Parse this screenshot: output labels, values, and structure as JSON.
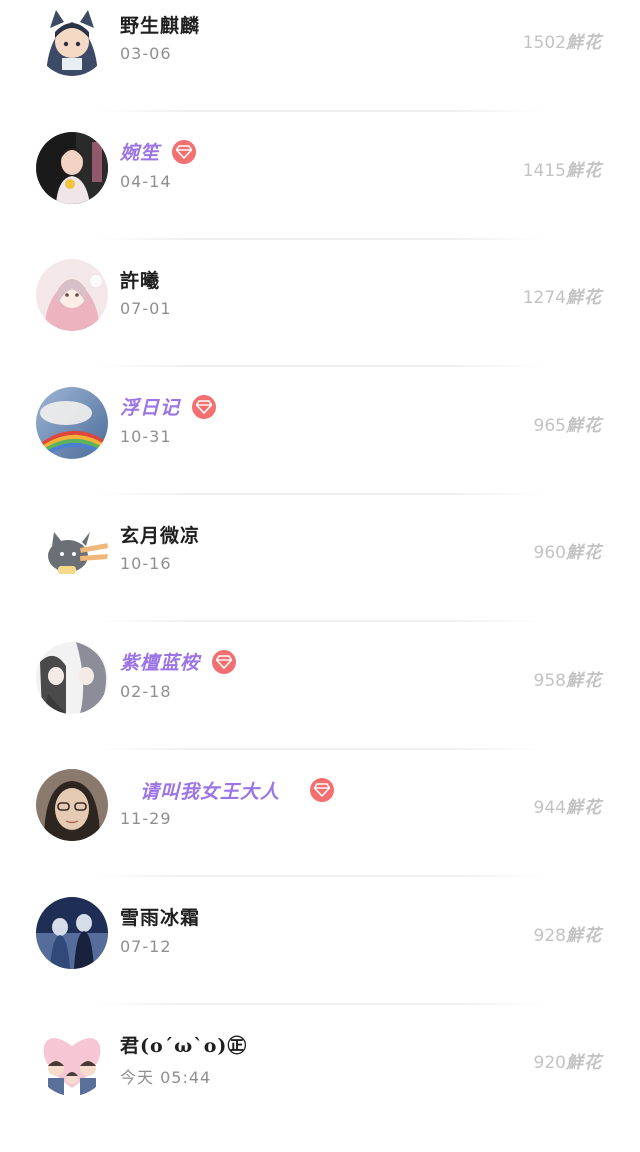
{
  "ranking": {
    "items": [
      {
        "name": "野生麒麟",
        "date": "03-06",
        "count": "1502",
        "unit": "鮮花",
        "vip": false,
        "avatar": "avatar-boy-hood",
        "avatar_colors": [
          "#3d4a66",
          "#f5d9c4",
          "#2b3347"
        ]
      },
      {
        "name": "婉笙",
        "date": "04-14",
        "count": "1415",
        "unit": "鮮花",
        "vip": true,
        "avatar": "avatar-girl-photo",
        "avatar_colors": [
          "#1a1a1a",
          "#f0e6ea",
          "#d87a9a"
        ]
      },
      {
        "name": "許曦",
        "date": "07-01",
        "count": "1274",
        "unit": "鮮花",
        "vip": false,
        "avatar": "avatar-anime-girl",
        "avatar_colors": [
          "#f3e7ea",
          "#e8a7b4",
          "#d8c0c8"
        ]
      },
      {
        "name": "浮日记",
        "date": "10-31",
        "count": "965",
        "unit": "鮮花",
        "vip": true,
        "avatar": "avatar-sky-rainbow",
        "avatar_colors": [
          "#6f8fb8",
          "#c9a86a",
          "#4a6b98"
        ]
      },
      {
        "name": "玄月微凉",
        "date": "10-16",
        "count": "960",
        "unit": "鮮花",
        "vip": false,
        "avatar": "avatar-cartoon-cat",
        "avatar_colors": [
          "#ffffff",
          "#6b6f76",
          "#f0b77a"
        ]
      },
      {
        "name": "紫檀蓝桉",
        "date": "02-18",
        "count": "958",
        "unit": "鮮花",
        "vip": true,
        "avatar": "avatar-ink-couple",
        "avatar_colors": [
          "#f2f2f2",
          "#2a2a2a",
          "#8d8d9a"
        ]
      },
      {
        "name": "请叫我女王大人",
        "date": "11-29",
        "count": "944",
        "unit": "鮮花",
        "vip": true,
        "avatar": "avatar-glasses-woman",
        "avatar_colors": [
          "#8a7a6e",
          "#e6cbb4",
          "#2e2420"
        ]
      },
      {
        "name": "雪雨冰霜",
        "date": "07-12",
        "count": "928",
        "unit": "鮮花",
        "vip": false,
        "avatar": "avatar-blue-couple",
        "avatar_colors": [
          "#1e2e55",
          "#6d88b8",
          "#d6dde9"
        ]
      },
      {
        "name": "君(o´ω`o)㊣",
        "date": "今天 05:44",
        "count": "920",
        "unit": "鮮花",
        "vip": false,
        "avatar": "avatar-heart-family",
        "avatar_colors": [
          "#f6c6d4",
          "#ffffff",
          "#4a3a3a"
        ]
      }
    ]
  },
  "colors": {
    "vip_name": "#9b74e6",
    "vip_badge": "#f46f6f",
    "name": "#1f1f1f",
    "date": "#8f8f8f",
    "flowers": "#c3c3c3"
  }
}
